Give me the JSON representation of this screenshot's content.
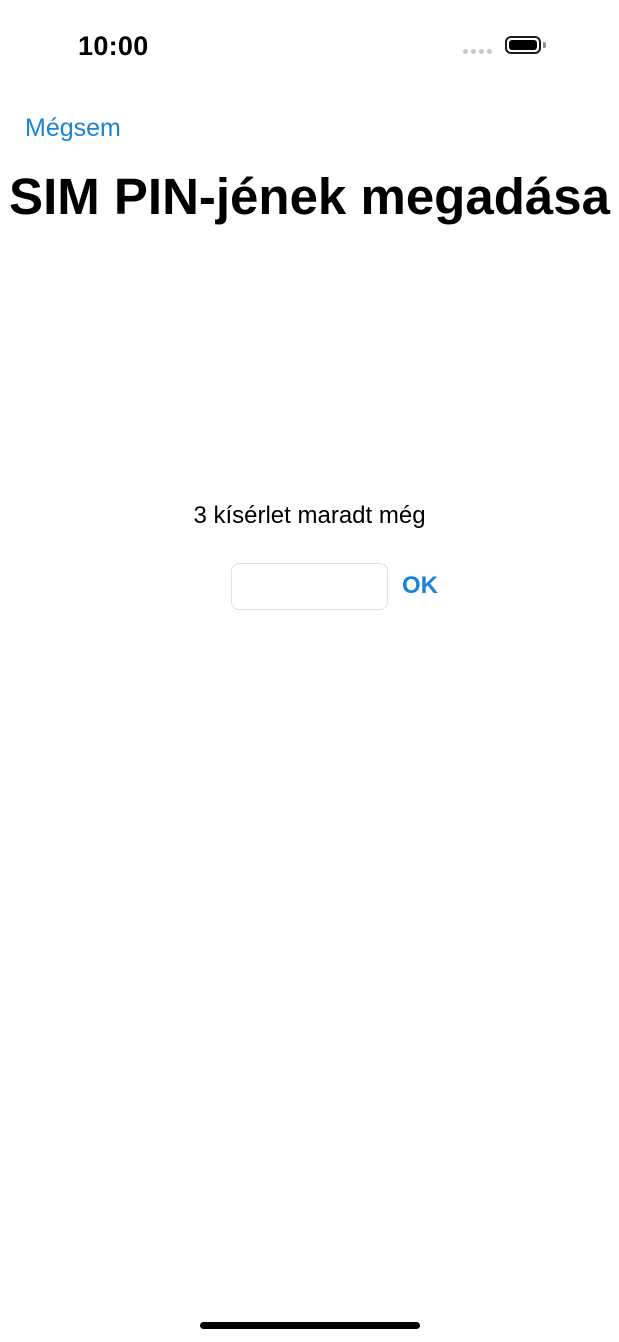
{
  "status_bar": {
    "time": "10:00"
  },
  "navigation": {
    "cancel_label": "Mégsem"
  },
  "title": "SIM PIN-jének megadása",
  "attempts_text": "3 kísérlet maradt még",
  "pin_field": {
    "value": "",
    "placeholder": ""
  },
  "ok_label": "OK",
  "colors": {
    "accent": "#1a84d6"
  }
}
